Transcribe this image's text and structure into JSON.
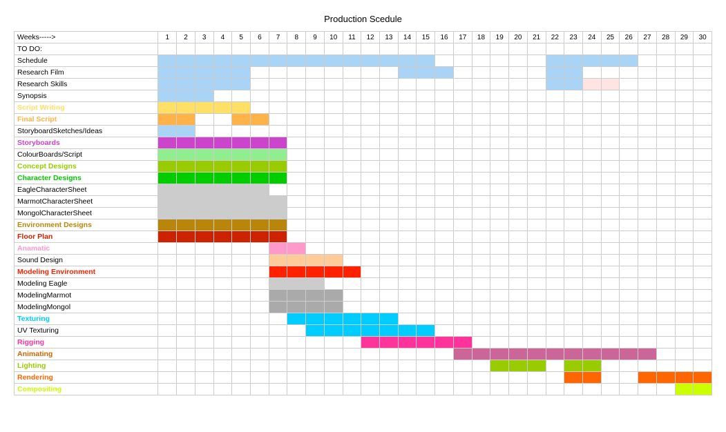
{
  "title": "Production Scedule",
  "header": {
    "weeks_label": "Weeks----->",
    "week_numbers": [
      1,
      2,
      3,
      4,
      5,
      6,
      7,
      8,
      9,
      10,
      11,
      12,
      13,
      14,
      15,
      16,
      17,
      18,
      19,
      20,
      21,
      22,
      23,
      24,
      25,
      26,
      27,
      28,
      29,
      30
    ]
  },
  "rows": [
    {
      "label": "TO DO:",
      "color": null,
      "label_color": null,
      "cells": []
    },
    {
      "label": "Schedule",
      "color": "#aad4f5",
      "label_color": null,
      "cells": [
        {
          "start": 1,
          "end": 7,
          "color": "#aad4f5"
        },
        {
          "start": 8,
          "end": 15,
          "color": "#aad4f5"
        },
        {
          "start": 22,
          "end": 26,
          "color": "#aad4f5"
        }
      ]
    },
    {
      "label": "Research Film",
      "color": null,
      "label_color": null,
      "cells": [
        {
          "start": 1,
          "end": 5,
          "color": "#aad4f5"
        },
        {
          "start": 14,
          "end": 16,
          "color": "#aad4f5"
        },
        {
          "start": 22,
          "end": 23,
          "color": "#aad4f5"
        }
      ]
    },
    {
      "label": "Research Skills",
      "color": null,
      "label_color": null,
      "cells": [
        {
          "start": 1,
          "end": 5,
          "color": "#aad4f5"
        },
        {
          "start": 22,
          "end": 23,
          "color": "#aad4f5"
        },
        {
          "start": 24,
          "end": 25,
          "color": "#ffe4e4"
        }
      ]
    },
    {
      "label": "Synopsis",
      "color": null,
      "label_color": null,
      "cells": [
        {
          "start": 1,
          "end": 3,
          "color": "#aad4f5"
        }
      ]
    },
    {
      "label": "Script Writing",
      "color": "#ffe066",
      "label_color": "#ffe066",
      "cells": [
        {
          "start": 1,
          "end": 2,
          "color": "#ffe066"
        },
        {
          "start": 3,
          "end": 4,
          "color": "#ffe066"
        },
        {
          "start": 5,
          "end": 5,
          "color": "#ffe066"
        }
      ]
    },
    {
      "label": "Final Script",
      "color": "#ffb347",
      "label_color": "#ffb347",
      "cells": [
        {
          "start": 1,
          "end": 2,
          "color": "#ffb347"
        },
        {
          "start": 5,
          "end": 6,
          "color": "#ffb347"
        }
      ]
    },
    {
      "label": "StoryboardSketches/Ideas",
      "color": null,
      "label_color": null,
      "cells": [
        {
          "start": 1,
          "end": 2,
          "color": "#aad4f5"
        }
      ]
    },
    {
      "label": "Storyboards",
      "color": "#cc44cc",
      "label_color": "#cc44cc",
      "cells": [
        {
          "start": 1,
          "end": 5,
          "color": "#cc44cc"
        },
        {
          "start": 6,
          "end": 7,
          "color": "#cc44cc"
        }
      ]
    },
    {
      "label": "ColourBoards/Script",
      "color": null,
      "label_color": null,
      "cells": [
        {
          "start": 1,
          "end": 7,
          "color": "#90ee90"
        }
      ]
    },
    {
      "label": "Concept Designs",
      "color": "#99cc00",
      "label_color": "#99cc00",
      "cells": [
        {
          "start": 1,
          "end": 7,
          "color": "#99cc00"
        }
      ]
    },
    {
      "label": "Character Designs",
      "color": "#00cc00",
      "label_color": "#00cc00",
      "cells": [
        {
          "start": 1,
          "end": 6,
          "color": "#00cc00"
        },
        {
          "start": 7,
          "end": 7,
          "color": "#00cc00"
        }
      ]
    },
    {
      "label": "EagleCharacterSheet",
      "color": null,
      "label_color": null,
      "cells": [
        {
          "start": 1,
          "end": 6,
          "color": "#cccccc"
        }
      ]
    },
    {
      "label": "MarmotCharacterSheet",
      "color": null,
      "label_color": null,
      "cells": [
        {
          "start": 1,
          "end": 7,
          "color": "#cccccc"
        }
      ]
    },
    {
      "label": "MongolCharacterSheet",
      "color": null,
      "label_color": null,
      "cells": [
        {
          "start": 1,
          "end": 7,
          "color": "#cccccc"
        }
      ]
    },
    {
      "label": "Environment Designs",
      "color": "#b8860b",
      "label_color": "#b8860b",
      "cells": [
        {
          "start": 1,
          "end": 7,
          "color": "#b8860b"
        }
      ]
    },
    {
      "label": "Floor Plan",
      "color": "#cc2200",
      "label_color": "#cc2200",
      "cells": [
        {
          "start": 1,
          "end": 6,
          "color": "#cc2200"
        },
        {
          "start": 7,
          "end": 7,
          "color": "#cc2200"
        }
      ]
    },
    {
      "label": "Anamatic",
      "color": "#ff99cc",
      "label_color": "#ff99cc",
      "cells": [
        {
          "start": 7,
          "end": 8,
          "color": "#ff99cc"
        }
      ]
    },
    {
      "label": "Sound Design",
      "color": null,
      "label_color": null,
      "cells": [
        {
          "start": 7,
          "end": 8,
          "color": "#ffcc99"
        },
        {
          "start": 9,
          "end": 10,
          "color": "#ffcc99"
        }
      ]
    },
    {
      "label": "Modeling Environment",
      "color": "#ff2200",
      "label_color": "#ff2200",
      "cells": [
        {
          "start": 7,
          "end": 9,
          "color": "#ff2200"
        },
        {
          "start": 10,
          "end": 10,
          "color": "#ff2200"
        },
        {
          "start": 11,
          "end": 11,
          "color": "#ff2200"
        }
      ]
    },
    {
      "label": "Modeling Eagle",
      "color": null,
      "label_color": null,
      "cells": [
        {
          "start": 7,
          "end": 9,
          "color": "#cccccc"
        }
      ]
    },
    {
      "label": "ModelingMarmot",
      "color": null,
      "label_color": null,
      "cells": [
        {
          "start": 7,
          "end": 10,
          "color": "#aaaaaa"
        }
      ]
    },
    {
      "label": "ModelingMongol",
      "color": null,
      "label_color": null,
      "cells": [
        {
          "start": 7,
          "end": 10,
          "color": "#aaaaaa"
        }
      ]
    },
    {
      "label": "Texturing",
      "color": "#00ccff",
      "label_color": "#00ccff",
      "cells": [
        {
          "start": 8,
          "end": 13,
          "color": "#00ccff"
        }
      ]
    },
    {
      "label": "UV Texturing",
      "color": null,
      "label_color": null,
      "cells": [
        {
          "start": 9,
          "end": 15,
          "color": "#00ccff"
        }
      ]
    },
    {
      "label": "Rigging",
      "color": "#ff3399",
      "label_color": "#ff3399",
      "cells": [
        {
          "start": 12,
          "end": 16,
          "color": "#ff3399"
        },
        {
          "start": 17,
          "end": 17,
          "color": "#ff3399"
        }
      ]
    },
    {
      "label": "Animating",
      "color": "#ff9900",
      "label_color": "#cc6600",
      "cells": [
        {
          "start": 17,
          "end": 19,
          "color": "#cc6699"
        },
        {
          "start": 20,
          "end": 26,
          "color": "#cc6699"
        },
        {
          "start": 27,
          "end": 27,
          "color": "#cc6699"
        }
      ]
    },
    {
      "label": "Lighting",
      "color": "#99cc00",
      "label_color": "#99cc00",
      "cells": [
        {
          "start": 19,
          "end": 21,
          "color": "#99cc00"
        },
        {
          "start": 23,
          "end": 24,
          "color": "#99cc00"
        }
      ]
    },
    {
      "label": "Rendering",
      "color": "#ff6600",
      "label_color": "#ff6600",
      "cells": [
        {
          "start": 23,
          "end": 24,
          "color": "#ff6600"
        },
        {
          "start": 27,
          "end": 28,
          "color": "#ff6600"
        },
        {
          "start": 29,
          "end": 30,
          "color": "#ff6600"
        }
      ]
    },
    {
      "label": "Compositing",
      "color": "#ccff00",
      "label_color": "#ccff00",
      "cells": [
        {
          "start": 29,
          "end": 30,
          "color": "#ccff00"
        }
      ]
    }
  ]
}
